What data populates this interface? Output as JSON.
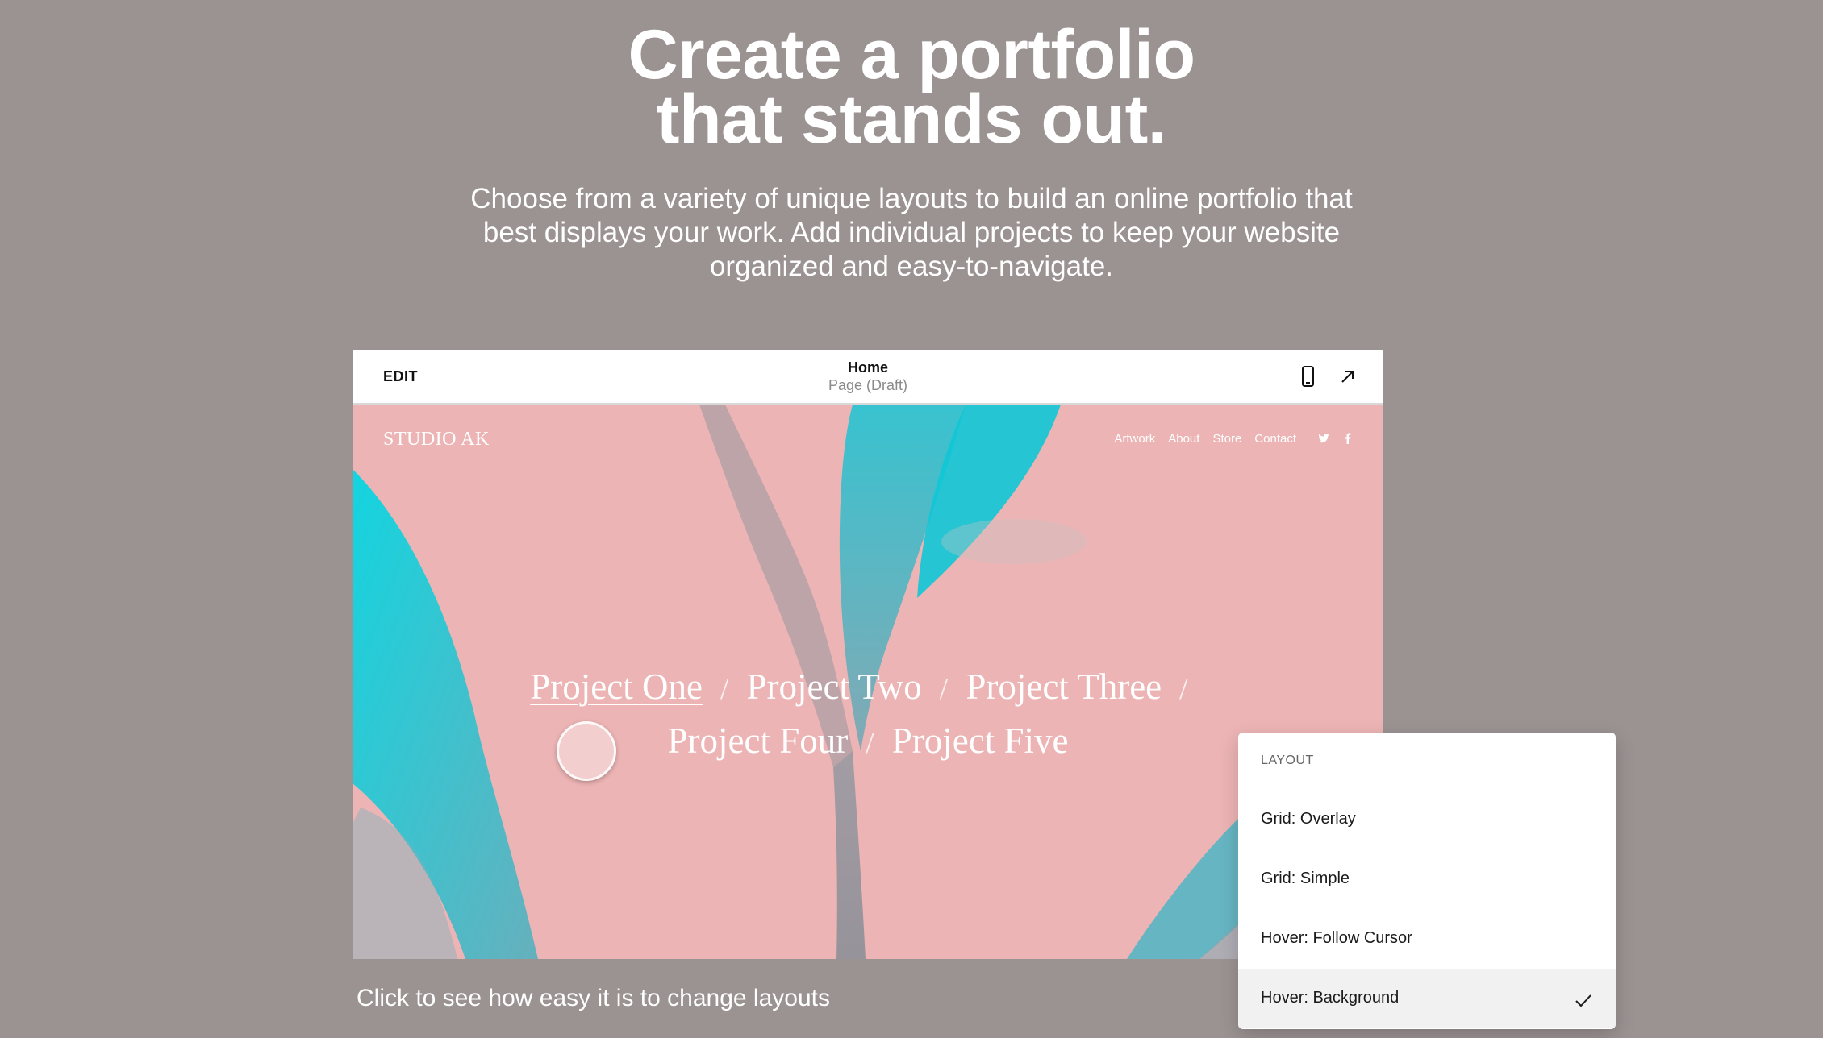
{
  "hero": {
    "title_line1": "Create a portfolio",
    "title_line2": "that stands out.",
    "subtitle": "Choose from a variety of unique layouts to build an online portfolio that best displays your work. Add individual projects to keep your website organized and easy-to-navigate."
  },
  "editor": {
    "edit_label": "EDIT",
    "page_title": "Home",
    "page_status": "Page (Draft)",
    "icons": [
      "mobile-preview-icon",
      "open-external-icon"
    ]
  },
  "site": {
    "logo": "STUDIO AK",
    "nav": [
      "Artwork",
      "About",
      "Store",
      "Contact"
    ],
    "social_icons": [
      "twitter-icon",
      "facebook-icon"
    ],
    "projects": [
      "Project One",
      "Project Two",
      "Project Three",
      "Project Four",
      "Project Five"
    ],
    "separator": "/",
    "active_project": "Project One",
    "background_color": "#ecb4b4",
    "accent_color": "#29c6d6"
  },
  "caption": "Click to see how easy it is to change layouts",
  "layout_panel": {
    "heading": "LAYOUT",
    "options": [
      {
        "label": "Grid: Overlay",
        "selected": false
      },
      {
        "label": "Grid: Simple",
        "selected": false
      },
      {
        "label": "Hover: Follow Cursor",
        "selected": false
      },
      {
        "label": "Hover: Background",
        "selected": true
      }
    ]
  }
}
